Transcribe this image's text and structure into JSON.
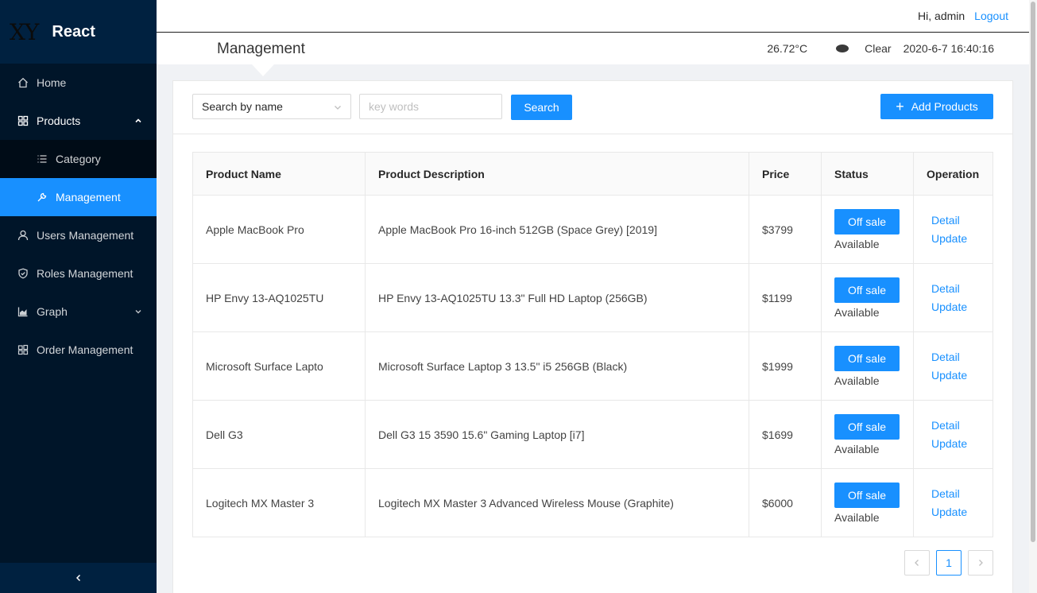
{
  "sidebar": {
    "logo_mark": "XY",
    "logo_title": "React",
    "items": [
      {
        "label": "Home",
        "icon": "home-icon"
      },
      {
        "label": "Products",
        "icon": "appstore-icon",
        "open": true
      },
      {
        "label": "Category",
        "icon": "bars-icon"
      },
      {
        "label": "Management",
        "icon": "tool-icon",
        "selected": true
      },
      {
        "label": "Users Management",
        "icon": "user-icon"
      },
      {
        "label": "Roles Management",
        "icon": "safety-icon"
      },
      {
        "label": "Graph",
        "icon": "area-chart-icon"
      },
      {
        "label": "Order Management",
        "icon": "windows-icon"
      }
    ],
    "collapse_icon": "chevron-left-icon"
  },
  "header": {
    "greeting": "Hi, admin",
    "logout_label": "Logout",
    "page_title": "Management",
    "temperature": "26.72°C",
    "weather": "Clear",
    "datetime": "2020-6-7 16:40:16"
  },
  "toolbar": {
    "search_type": "Search by name",
    "keywords_placeholder": "key words",
    "search_label": "Search",
    "add_label": "Add Products"
  },
  "table": {
    "columns": [
      "Product Name",
      "Product Description",
      "Price",
      "Status",
      "Operation"
    ],
    "rows": [
      {
        "name": "Apple MacBook Pro",
        "description": "Apple MacBook Pro 16-inch 512GB (Space Grey) [2019]",
        "price": "$3799",
        "status_button": "Off sale",
        "status": "Available",
        "detail": "Detail",
        "update": "Update"
      },
      {
        "name": "HP Envy 13-AQ1025TU",
        "description": "HP Envy 13-AQ1025TU 13.3\" Full HD Laptop (256GB)",
        "price": "$1199",
        "status_button": "Off sale",
        "status": "Available",
        "detail": "Detail",
        "update": "Update"
      },
      {
        "name": "Microsoft Surface Lapto",
        "description": "Microsoft Surface Laptop 3 13.5\" i5 256GB (Black)",
        "price": "$1999",
        "status_button": "Off sale",
        "status": "Available",
        "detail": "Detail",
        "update": "Update"
      },
      {
        "name": "Dell G3",
        "description": "Dell G3 15 3590 15.6\" Gaming Laptop [i7]",
        "price": "$1699",
        "status_button": "Off sale",
        "status": "Available",
        "detail": "Detail",
        "update": "Update"
      },
      {
        "name": "Logitech MX Master 3",
        "description": "Logitech MX Master 3 Advanced Wireless Mouse (Graphite)",
        "price": "$6000",
        "status_button": "Off sale",
        "status": "Available",
        "detail": "Detail",
        "update": "Update"
      }
    ]
  },
  "pagination": {
    "current_page": "1"
  },
  "colors": {
    "primary": "#1890ff",
    "sider": "#001529",
    "sider_dark": "#000c17"
  }
}
